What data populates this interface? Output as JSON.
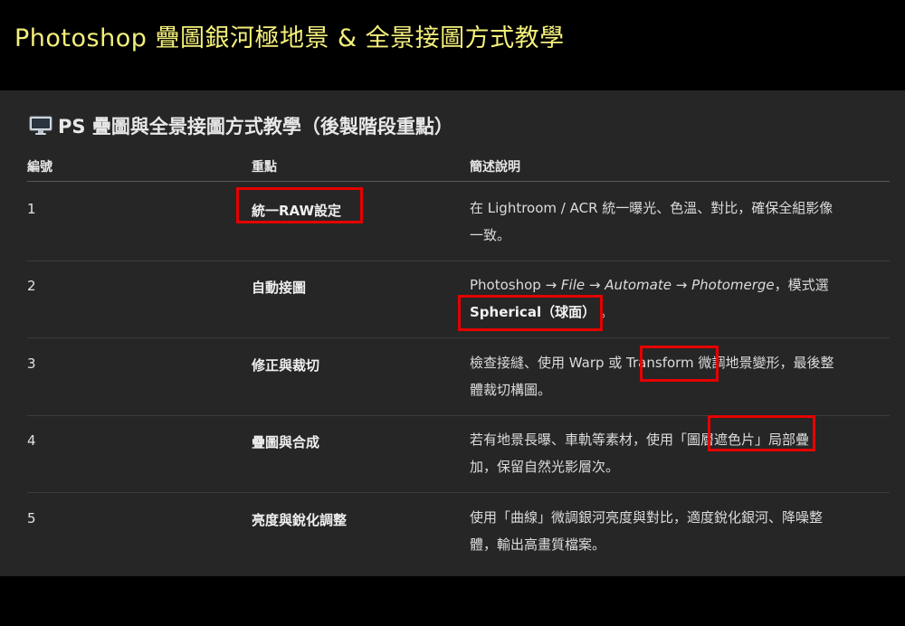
{
  "page_title": "Photoshop 疊圖銀河極地景 & 全景接圖方式教學",
  "section": {
    "icon": "monitor-icon",
    "title": "PS 疊圖與全景接圖方式教學（後製階段重點）"
  },
  "table": {
    "headers": [
      "編號",
      "重點",
      "簡述說明"
    ],
    "rows": [
      {
        "num": "1",
        "key": "統一RAW設定",
        "desc": [
          "在 Lightroom / ACR 統一曝光、色溫、對比，確保全組影像",
          "一致。"
        ]
      },
      {
        "num": "2",
        "key": "自動接圖",
        "desc_parts": {
          "a": "Photoshop → ",
          "b": "File",
          "c": " → ",
          "d": "Automate",
          "e": " → ",
          "f": "Photomerge",
          "g": "，模式選",
          "h": "Spherical（球面）",
          "i": "。"
        }
      },
      {
        "num": "3",
        "key": "修正與裁切",
        "desc": [
          "檢查接縫、使用 Warp 或 Transform 微調地景變形，最後整",
          "體裁切構圖。"
        ]
      },
      {
        "num": "4",
        "key": "疊圖與合成",
        "desc": [
          "若有地景長曝、車軌等素材，使用「圖層遮色片」局部疊",
          "加，保留自然光影層次。"
        ]
      },
      {
        "num": "5",
        "key": "亮度與銳化調整",
        "desc": [
          "使用「曲線」微調銀河亮度與對比，適度銳化銀河、降噪整",
          "體，輸出高畫質檔案。"
        ]
      }
    ]
  },
  "colors": {
    "title_yellow": "#f3ef7a",
    "highlight_red": "#e60000",
    "panel_bg": "#262626"
  }
}
